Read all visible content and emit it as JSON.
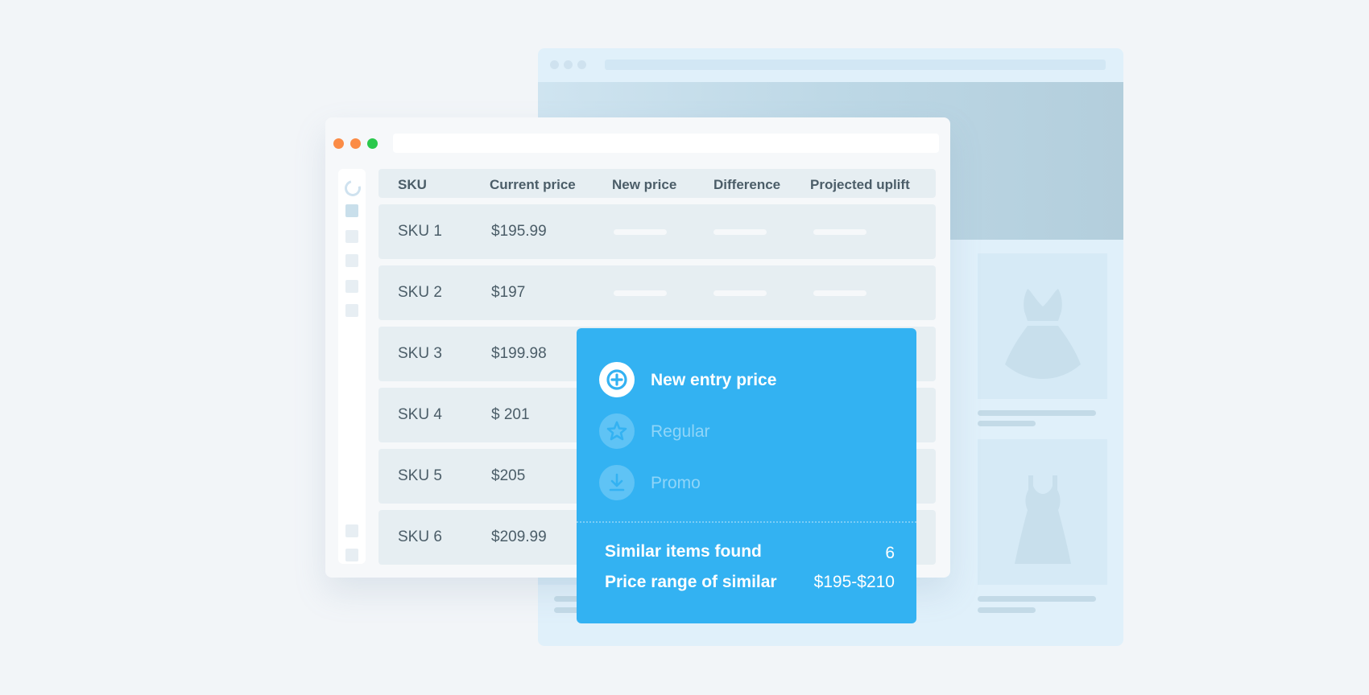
{
  "colors": {
    "page_bg": "#f2f5f8",
    "accent": "#33b2f2",
    "traffic_close": "#fb8c46",
    "traffic_min": "#fb8c46",
    "traffic_max": "#2ac84c",
    "text_dark": "#4b5d68"
  },
  "front_window": {
    "traffic_lights": [
      "close",
      "minimize",
      "maximize"
    ],
    "address_bar": "",
    "sidebar": {
      "icons": [
        "loader-icon",
        "nav-item",
        "nav-item",
        "nav-item",
        "nav-item",
        "nav-item",
        "nav-item",
        "nav-item"
      ]
    },
    "table": {
      "columns": [
        "SKU",
        "Current price",
        "New price",
        "Difference",
        "Projected uplift"
      ],
      "rows": [
        {
          "sku": "SKU 1",
          "current_price": "$195.99"
        },
        {
          "sku": "SKU 2",
          "current_price": "$197"
        },
        {
          "sku": "SKU 3",
          "current_price": "$199.98"
        },
        {
          "sku": "SKU 4",
          "current_price": "$ 201"
        },
        {
          "sku": "SKU 5",
          "current_price": "$205"
        },
        {
          "sku": "SKU 6",
          "current_price": "$209.99"
        }
      ]
    }
  },
  "popup": {
    "options": [
      {
        "label": "New entry price",
        "icon": "plus-circle-icon",
        "selected": true
      },
      {
        "label": "Regular",
        "icon": "star-icon",
        "selected": false
      },
      {
        "label": "Promo",
        "icon": "download-icon",
        "selected": false
      }
    ],
    "stats": [
      {
        "label": "Similar items found",
        "value": "6"
      },
      {
        "label": "Price range of similar",
        "value": "$195-$210"
      }
    ]
  },
  "back_browser": {
    "products": [
      {
        "icon": "dress-icon",
        "style": "flared"
      },
      {
        "icon": "dress-icon",
        "style": "a-line"
      }
    ]
  }
}
